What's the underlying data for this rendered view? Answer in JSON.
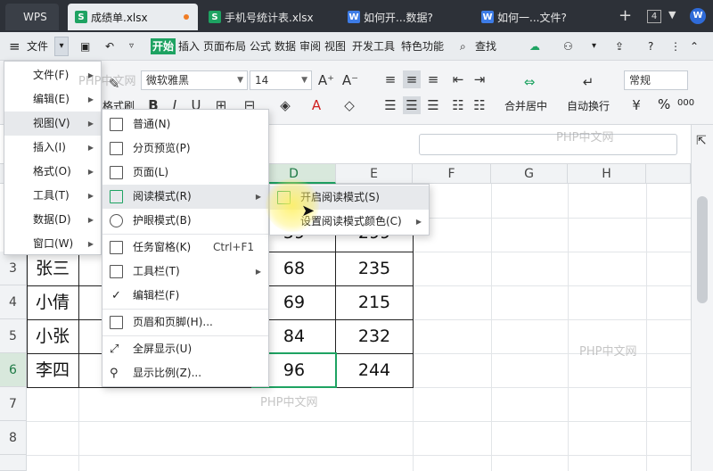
{
  "tabs": {
    "app": "WPS",
    "t1": "成绩单.xlsx",
    "t2": "手机号统计表.xlsx",
    "t3": "如何开...数据?",
    "t4": "如何一...文件?",
    "count": "4"
  },
  "menubar": {
    "file": "文件",
    "start": "开始",
    "insert": "插入",
    "layout": "页面布局",
    "formula": "公式",
    "data": "数据",
    "review": "审阅",
    "view": "视图",
    "dev": "开发工具",
    "features": "特色功能",
    "search": "查找"
  },
  "ribbon": {
    "font_name": "微软雅黑",
    "font_size": "14",
    "format_brush": "格式刷",
    "merge_center": "合并居中",
    "auto_wrap": "自动换行",
    "number_format": "常规",
    "percent": "%",
    "thousands": "000"
  },
  "file_menu": {
    "items": [
      {
        "label": "文件(F)"
      },
      {
        "label": "编辑(E)"
      },
      {
        "label": "视图(V)"
      },
      {
        "label": "插入(I)"
      },
      {
        "label": "格式(O)"
      },
      {
        "label": "工具(T)"
      },
      {
        "label": "数据(D)"
      },
      {
        "label": "窗口(W)"
      }
    ]
  },
  "view_menu": {
    "items": [
      {
        "label": "普通(N)"
      },
      {
        "label": "分页预览(P)"
      },
      {
        "label": "页面(L)"
      },
      {
        "label": "阅读模式(R)"
      },
      {
        "label": "护眼模式(B)"
      },
      {
        "label": "任务窗格(K)",
        "shortcut": "Ctrl+F1"
      },
      {
        "label": "工具栏(T)"
      },
      {
        "label": "编辑栏(F)"
      },
      {
        "label": "页眉和页脚(H)..."
      },
      {
        "label": "全屏显示(U)"
      },
      {
        "label": "显示比例(Z)..."
      }
    ]
  },
  "reading_menu": {
    "items": [
      {
        "label": "开启阅读模式(S)"
      },
      {
        "label": "设置阅读模式颜色(C)"
      }
    ]
  },
  "grid": {
    "columns": [
      "D",
      "E",
      "F",
      "G",
      "H"
    ],
    "rows": [
      "3",
      "4",
      "5",
      "6",
      "7",
      "8"
    ],
    "data": [
      {
        "name": "张三",
        "d": "68",
        "e": "235"
      },
      {
        "name": "小倩",
        "d": "69",
        "e": "215"
      },
      {
        "name": "小张",
        "d": "84",
        "e": "232"
      },
      {
        "name": "李四",
        "d": "96",
        "e": "244"
      }
    ],
    "partial_row": {
      "d": "59",
      "e": "299"
    }
  },
  "watermarks": [
    "PHP中文网",
    "PHP中文网",
    "PHP中文网",
    "PHP中文网"
  ],
  "colors": {
    "accent": "#1ea362",
    "tabbar": "#2d3138",
    "wps_blue": "#3d7ce6"
  }
}
